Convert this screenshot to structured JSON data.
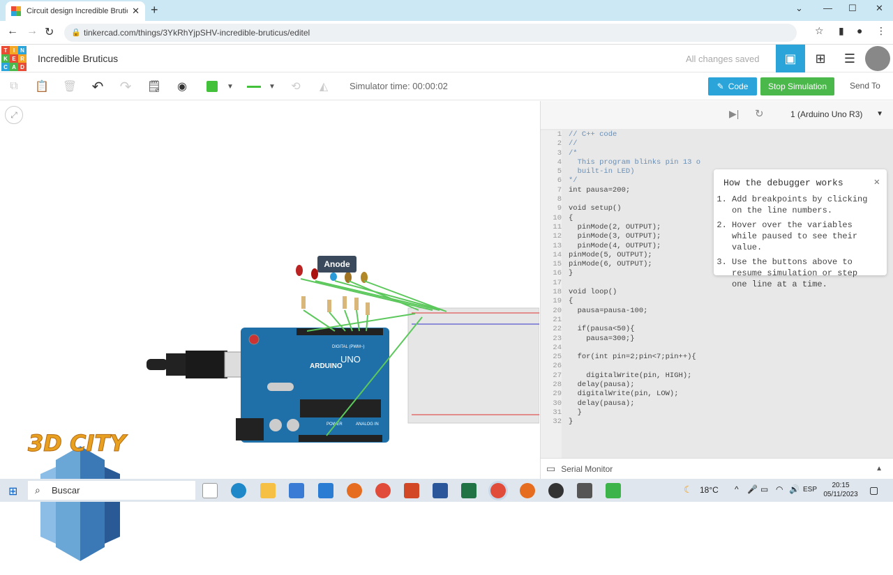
{
  "browser": {
    "tab_title": "Circuit design Incredible Bruticu",
    "url": "tinkercad.com/things/3YkRhYjpSHV-incredible-bruticus/editel"
  },
  "header": {
    "logo_letters": [
      "TIN",
      "KER",
      "CAD"
    ],
    "project_name": "Incredible Bruticus",
    "save_status": "All changes saved"
  },
  "toolbar": {
    "simulator_time": "Simulator time: 00:00:02",
    "code_label": "Code",
    "stop_label": "Stop Simulation",
    "send_label": "Send To",
    "fill_color": "#44c13a"
  },
  "circuit": {
    "tooltip": "Anode",
    "board_brand": "ARDUINO",
    "board_model": "UNO",
    "digital_label": "DIGITAL (PWM~)",
    "power_label": "POWER",
    "analog_label": "ANALOG IN"
  },
  "code_panel": {
    "device": "1 (Arduino Uno R3)",
    "serial_monitor": "Serial Monitor",
    "line_numbers": [
      "1",
      "2",
      "3",
      "4",
      "5",
      "6",
      "7",
      "8",
      "9",
      "10",
      "11",
      "12",
      "13",
      "14",
      "15",
      "16",
      "17",
      "18",
      "19",
      "20",
      "21",
      "22",
      "23",
      "24",
      "25",
      "26",
      "27",
      "28",
      "29",
      "30",
      "31",
      "32"
    ],
    "lines": [
      "// C++ code",
      "//",
      "/*",
      "  This program blinks pin 13 o",
      "  built-in LED)",
      "*/",
      "int pausa=200;",
      "",
      "void setup()",
      "{",
      "  pinMode(2, OUTPUT);",
      "  pinMode(3, OUTPUT);",
      "  pinMode(4, OUTPUT);",
      "pinMode(5, OUTPUT);",
      "pinMode(6, OUTPUT);",
      "}",
      "",
      "void loop()",
      "{",
      "  pausa=pausa-100;",
      "",
      "  if(pausa<50){",
      "    pausa=300;}",
      "",
      "  for(int pin=2;pin<7;pin++){",
      "",
      "    digitalWrite(pin, HIGH);",
      "  delay(pausa);",
      "  digitalWrite(pin, LOW);",
      "  delay(pausa);",
      "  }",
      "}"
    ],
    "debugger": {
      "title": "How the debugger works",
      "steps": [
        "Add breakpoints by clicking on the line numbers.",
        "Hover over the variables while paused to see their value.",
        "Use the buttons above to resume simulation or step one line at a time."
      ]
    }
  },
  "watermark": {
    "text": "3D CITY"
  },
  "taskbar": {
    "search_placeholder": "Buscar",
    "temperature": "18°C",
    "language": "ESP",
    "time": "20:15",
    "date": "05/11/2023"
  }
}
